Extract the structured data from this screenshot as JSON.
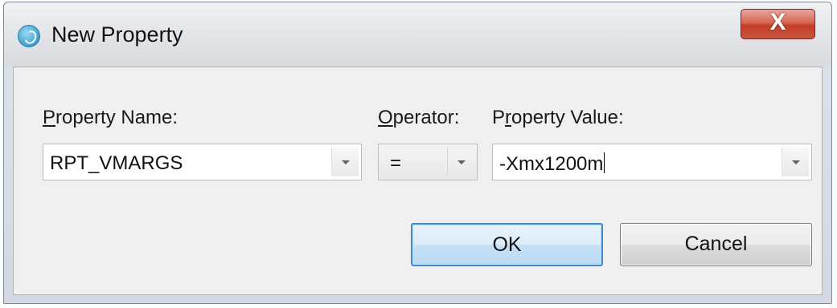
{
  "window": {
    "title": "New Property",
    "close_label": "X",
    "app_icon": "eclipse-style-app-icon"
  },
  "form": {
    "property_name": {
      "label_accel": "P",
      "label_rest": "roperty Name:",
      "value": "RPT_VMARGS"
    },
    "operator": {
      "label_accel": "O",
      "label_rest": "perator:",
      "value": "="
    },
    "property_value": {
      "label_pre": "P",
      "label_accel": "r",
      "label_rest": "operty Value:",
      "value": "-Xmx1200m"
    }
  },
  "buttons": {
    "ok": "OK",
    "cancel": "Cancel"
  },
  "colors": {
    "close_button": "#c9553f",
    "ok_border": "#3c8bd3"
  }
}
